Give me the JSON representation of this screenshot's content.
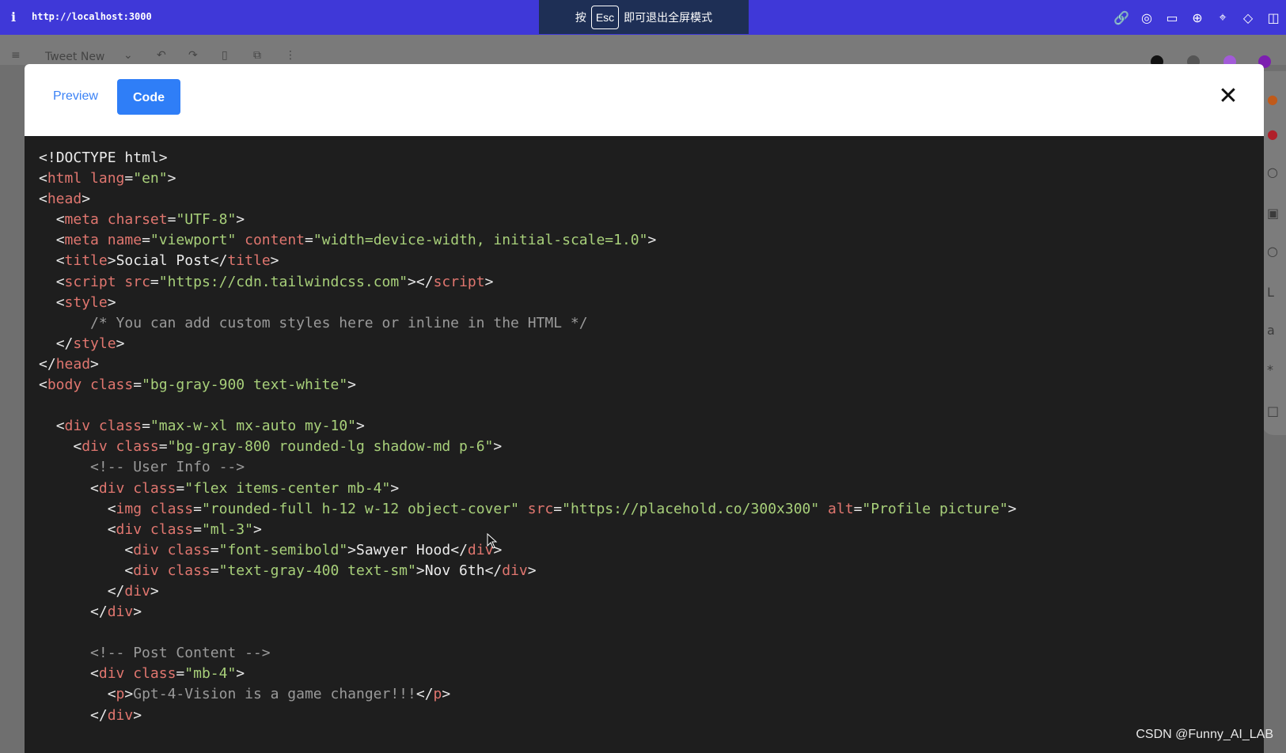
{
  "browser": {
    "info_icon": "i",
    "url": "http://localhost:3000",
    "esc_banner": {
      "prefix": "按",
      "key": "Esc",
      "suffix": "即可退出全屏模式"
    },
    "toolbar_icons": [
      "link-icon",
      "camera-icon",
      "window-icon",
      "globe-icon",
      "target-icon",
      "code-icon",
      "panel-icon"
    ]
  },
  "background_editor": {
    "title": "Tweet New",
    "color_swatches": [
      "#111111",
      "#555555",
      "#a25bd8",
      "#7c1fb0"
    ]
  },
  "modal": {
    "tabs": [
      {
        "label": "Preview",
        "active": false
      },
      {
        "label": "Code",
        "active": true
      }
    ],
    "close_label": "✕",
    "code_lines": [
      [
        [
          "punc",
          "<!"
        ],
        [
          "txt",
          "DOCTYPE html"
        ],
        [
          "punc",
          ">"
        ]
      ],
      [
        [
          "punc",
          "<"
        ],
        [
          "tag",
          "html"
        ],
        [
          "attr",
          " lang"
        ],
        [
          "punc",
          "="
        ],
        [
          "str",
          "\"en\""
        ],
        [
          "punc",
          ">"
        ]
      ],
      [
        [
          "punc",
          "<"
        ],
        [
          "tag",
          "head"
        ],
        [
          "punc",
          ">"
        ]
      ],
      [
        [
          "txt",
          "  "
        ],
        [
          "punc",
          "<"
        ],
        [
          "tag",
          "meta"
        ],
        [
          "attr",
          " charset"
        ],
        [
          "punc",
          "="
        ],
        [
          "str",
          "\"UTF-8\""
        ],
        [
          "punc",
          ">"
        ]
      ],
      [
        [
          "txt",
          "  "
        ],
        [
          "punc",
          "<"
        ],
        [
          "tag",
          "meta"
        ],
        [
          "attr",
          " name"
        ],
        [
          "punc",
          "="
        ],
        [
          "str",
          "\"viewport\""
        ],
        [
          "attr",
          " content"
        ],
        [
          "punc",
          "="
        ],
        [
          "str",
          "\"width=device-width, initial-scale=1.0\""
        ],
        [
          "punc",
          ">"
        ]
      ],
      [
        [
          "txt",
          "  "
        ],
        [
          "punc",
          "<"
        ],
        [
          "tag",
          "title"
        ],
        [
          "punc",
          ">"
        ],
        [
          "txt",
          "Social Post"
        ],
        [
          "punc",
          "</"
        ],
        [
          "tag",
          "title"
        ],
        [
          "punc",
          ">"
        ]
      ],
      [
        [
          "txt",
          "  "
        ],
        [
          "punc",
          "<"
        ],
        [
          "tag",
          "script"
        ],
        [
          "attr",
          " src"
        ],
        [
          "punc",
          "="
        ],
        [
          "str",
          "\"https://cdn.tailwindcss.com\""
        ],
        [
          "punc",
          "></"
        ],
        [
          "tag",
          "script"
        ],
        [
          "punc",
          ">"
        ]
      ],
      [
        [
          "txt",
          "  "
        ],
        [
          "punc",
          "<"
        ],
        [
          "tag",
          "style"
        ],
        [
          "punc",
          ">"
        ]
      ],
      [
        [
          "cmt",
          "      /* You can add custom styles here or inline in the HTML */"
        ]
      ],
      [
        [
          "txt",
          "  "
        ],
        [
          "punc",
          "</"
        ],
        [
          "tag",
          "style"
        ],
        [
          "punc",
          ">"
        ]
      ],
      [
        [
          "punc",
          "</"
        ],
        [
          "tag",
          "head"
        ],
        [
          "punc",
          ">"
        ]
      ],
      [
        [
          "punc",
          "<"
        ],
        [
          "tag",
          "body"
        ],
        [
          "attr",
          " class"
        ],
        [
          "punc",
          "="
        ],
        [
          "str",
          "\"bg-gray-900 text-white\""
        ],
        [
          "punc",
          ">"
        ]
      ],
      [
        [
          "txt",
          ""
        ]
      ],
      [
        [
          "txt",
          "  "
        ],
        [
          "punc",
          "<"
        ],
        [
          "tag",
          "div"
        ],
        [
          "attr",
          " class"
        ],
        [
          "punc",
          "="
        ],
        [
          "str",
          "\"max-w-xl mx-auto my-10\""
        ],
        [
          "punc",
          ">"
        ]
      ],
      [
        [
          "txt",
          "    "
        ],
        [
          "punc",
          "<"
        ],
        [
          "tag",
          "div"
        ],
        [
          "attr",
          " class"
        ],
        [
          "punc",
          "="
        ],
        [
          "str",
          "\"bg-gray-800 rounded-lg shadow-md p-6\""
        ],
        [
          "punc",
          ">"
        ]
      ],
      [
        [
          "cmt",
          "      <!-- User Info -->"
        ]
      ],
      [
        [
          "txt",
          "      "
        ],
        [
          "punc",
          "<"
        ],
        [
          "tag",
          "div"
        ],
        [
          "attr",
          " class"
        ],
        [
          "punc",
          "="
        ],
        [
          "str",
          "\"flex items-center mb-4\""
        ],
        [
          "punc",
          ">"
        ]
      ],
      [
        [
          "txt",
          "        "
        ],
        [
          "punc",
          "<"
        ],
        [
          "tag",
          "img"
        ],
        [
          "attr",
          " class"
        ],
        [
          "punc",
          "="
        ],
        [
          "str",
          "\"rounded-full h-12 w-12 object-cover\""
        ],
        [
          "attr",
          " src"
        ],
        [
          "punc",
          "="
        ],
        [
          "str",
          "\"https://placehold.co/300x300\""
        ],
        [
          "attr",
          " alt"
        ],
        [
          "punc",
          "="
        ],
        [
          "str",
          "\"Profile picture\""
        ],
        [
          "punc",
          ">"
        ]
      ],
      [
        [
          "txt",
          "        "
        ],
        [
          "punc",
          "<"
        ],
        [
          "tag",
          "div"
        ],
        [
          "attr",
          " class"
        ],
        [
          "punc",
          "="
        ],
        [
          "str",
          "\"ml-3\""
        ],
        [
          "punc",
          ">"
        ]
      ],
      [
        [
          "txt",
          "          "
        ],
        [
          "punc",
          "<"
        ],
        [
          "tag",
          "div"
        ],
        [
          "attr",
          " class"
        ],
        [
          "punc",
          "="
        ],
        [
          "str",
          "\"font-semibold\""
        ],
        [
          "punc",
          ">"
        ],
        [
          "txt",
          "Sawyer Hood"
        ],
        [
          "punc",
          "</"
        ],
        [
          "tag",
          "div"
        ],
        [
          "punc",
          ">"
        ]
      ],
      [
        [
          "txt",
          "          "
        ],
        [
          "punc",
          "<"
        ],
        [
          "tag",
          "div"
        ],
        [
          "attr",
          " class"
        ],
        [
          "punc",
          "="
        ],
        [
          "str",
          "\"text-gray-400 text-sm\""
        ],
        [
          "punc",
          ">"
        ],
        [
          "txt",
          "Nov 6th"
        ],
        [
          "punc",
          "</"
        ],
        [
          "tag",
          "div"
        ],
        [
          "punc",
          ">"
        ]
      ],
      [
        [
          "txt",
          "        "
        ],
        [
          "punc",
          "</"
        ],
        [
          "tag",
          "div"
        ],
        [
          "punc",
          ">"
        ]
      ],
      [
        [
          "txt",
          "      "
        ],
        [
          "punc",
          "</"
        ],
        [
          "tag",
          "div"
        ],
        [
          "punc",
          ">"
        ]
      ],
      [
        [
          "txt",
          ""
        ]
      ],
      [
        [
          "cmt",
          "      <!-- Post Content -->"
        ]
      ],
      [
        [
          "txt",
          "      "
        ],
        [
          "punc",
          "<"
        ],
        [
          "tag",
          "div"
        ],
        [
          "attr",
          " class"
        ],
        [
          "punc",
          "="
        ],
        [
          "str",
          "\"mb-4\""
        ],
        [
          "punc",
          ">"
        ]
      ],
      [
        [
          "txt",
          "        "
        ],
        [
          "punc",
          "<"
        ],
        [
          "tag",
          "p"
        ],
        [
          "punc",
          ">"
        ],
        [
          "cmt",
          "Gpt-4-Vision is a game changer!!!"
        ],
        [
          "punc",
          "</"
        ],
        [
          "tag",
          "p"
        ],
        [
          "punc",
          ">"
        ]
      ],
      [
        [
          "txt",
          "      "
        ],
        [
          "punc",
          "</"
        ],
        [
          "tag",
          "div"
        ],
        [
          "punc",
          ">"
        ]
      ]
    ]
  },
  "watermark": "CSDN @Funny_AI_LAB"
}
